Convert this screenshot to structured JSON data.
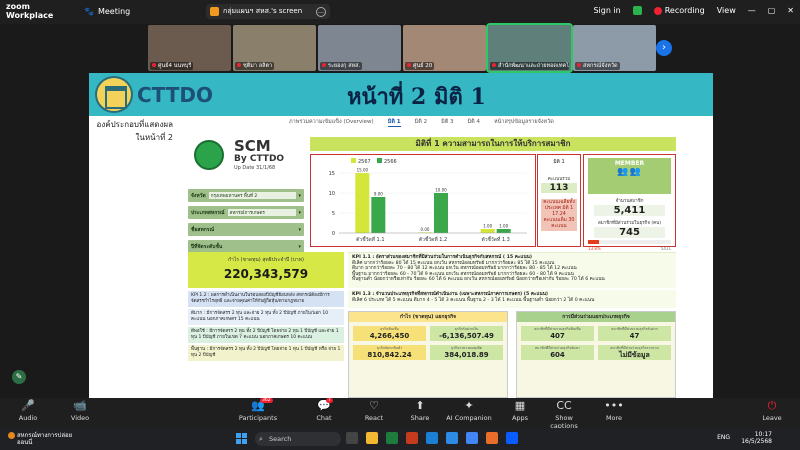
{
  "app": {
    "brand_line1": "zoom",
    "brand_line2": "Workplace",
    "meeting_label": "Meeting",
    "share_source": "กลุ่มแผนฯ สหส.'s screen",
    "sign_in": "Sign in",
    "recording": "Recording",
    "view": "View"
  },
  "participants_strip": [
    {
      "name": "ศูนย์4 นนทบุรี",
      "color": "#6b5b4e"
    },
    {
      "name": "ชุติมา ลลิตา",
      "color": "#8a7f6a"
    },
    {
      "name": "ระยองกุ สหส.",
      "color": "#7e8692"
    },
    {
      "name": "ศูนย์ 20",
      "color": "#a48876"
    },
    {
      "name": "สำนักพัฒนาและถ่ายทอดเทคโนฯ",
      "color": "#5e7f7a",
      "active": true
    },
    {
      "name": "สหกรณ์จังหวัด",
      "color": "#8d9aa7"
    }
  ],
  "slide": {
    "brand": "CTTDO",
    "title": "หน้าที่ 2 มิติ 1",
    "side_note_1": "องค์ประกอบที่แสดงผล",
    "side_note_2": "ในหน้าที่ 2",
    "tabs": [
      "ภาพรวมความเข้มแข็ง (Overview)",
      "มิติ 1",
      "มิติ 2",
      "มิติ 3",
      "มิติ 4",
      "หน้าสรุปข้อมูลรายจังหวัด"
    ],
    "scm": {
      "title": "SCM",
      "by": "By CTTDO",
      "update": "Up Date 31/1/68"
    },
    "filters": [
      {
        "label": "จังหวัด",
        "value": "กรุงเทพมหานคร พื้นที่ 2"
      },
      {
        "label": "ประเภทสหกรณ์",
        "value": "สหกรณ์การเกษตร"
      },
      {
        "label": "ชื่อสหกรณ์",
        "value": ""
      },
      {
        "label": "ปีที่จัดระดับชั้น",
        "value": ""
      }
    ],
    "dimension_title": "มิติที่ 1 ความสามารถในการให้บริการสมาชิก",
    "kpi1": {
      "label": "มิติ 1",
      "score_label": "คะแนนรวม",
      "score": "113",
      "avg_label": "คะแนนเฉลี่ยทั้งประเทศ มิติ 1",
      "avg": "17.24",
      "avg_suffix": "คะแนนเต็ม 30 คะแนน"
    },
    "member": {
      "header": "MEMBER",
      "total_label": "จำนวนสมาชิก",
      "total": "5,411",
      "active_label": "สมาชิกที่มีส่วนร่วมในธุรกิจ (คน)",
      "active": "745",
      "pct_text": "13.8%",
      "pct": 13.8,
      "bar_max_label": "5411"
    },
    "revenue": {
      "label": "กำไร (ขาดทุน) สุทธิประจำปี (บาท)",
      "value": "220,343,579"
    },
    "kpi12": {
      "head": "KPI 1.2 : ผลการดำเนินงานในรอบสองปีบัญชีย้อนหลัง สหกรณ์ต้องมีการจัดสรรกำไรสุทธิ และจ่ายคุณค่าให้กับผู้ถือหุ้น/ตามกฎหมาย",
      "items": [
        "ดีมาก : มีการจัดสรร 2 ทุน และจ่าย 2 ทุน ทั้ง 2 ปีบัญชี ภายใน/นอก 10 คะแนน นอกภาคเกษตร 15 คะแนน",
        "ดีพอใช้ : มีการจัดสรร 2 ทุน ทั้ง 2 ปีบัญชี โดยจ่าย 2 ทุน 1 ปีบัญชี และจ่าย 1 ทุน 1 ปีบัญชี ภายในเขต 7 คะแนน นอกภาคเกษตร 10 คะแนน",
        "พื้นฐาน : มีการจัดสรร 2 ทุน ทั้ง 2 ปีบัญชี โดยจ่าย 1 ทุน 1 ปีบัญชี หรือ จ่าย 1 ทุน 2 ปีบัญชี"
      ]
    },
    "kpi11": {
      "head": "KPI 1.1 : อัตราส่วนของสมาชิกที่มีส่วนร่วมในการดำเนินธุรกิจกับสหกรณ์ ( 15 คะแนน)",
      "lines": [
        "ดีเลิศ มากกว่าร้อยละ 80 ได้ 15 คะแนน ยกเว้น สหกรณ์ออมทรัพย์ มากกว่าร้อยละ 85 ได้ 15 คะแนน",
        "ดีมาก มากกว่าร้อยละ 70 - 80 ได้ 12 คะแนน ยกเว้น สหกรณ์ออมทรัพย์ มากกว่าร้อยละ 80 - 85 ได้ 12 คะแนน",
        "พื้นฐาน มากกว่าร้อยละ 60 - 70 ได้ 9 คะแนน ยกเว้น สหกรณ์ออมทรัพย์ มากกว่าร้อยละ 60 - 80 ได้ 9 คะแนน",
        "พื้นฐานต่ำ น้อยกว่าหรือเท่ากับ ร้อยละ 60 ได้ 6 คะแนน ยกเว้น สหกรณ์ออมทรัพย์ น้อยกว่าหรือเท่ากับ ร้อยละ 70 ได้ 6 คะแนน"
      ]
    },
    "kpi13": {
      "head": "KPI 1.3 : จำนวนประเภทธุรกิจที่สหกรณ์ดำเนินงาน (เฉพาะสหกรณ์ภาคการเกษตร) (5 คะแนน)",
      "line": "ดีเลิศ 6 ประเภท ได้ 5 คะแนน ดีมาก 4 - 5 ได้ 3 คะแนน พื้นฐาน 2 - 3 ได้ 1 คะแนน พื้นฐานต่ำ น้อยกว่า 2 ได้ 0 คะแนน"
    },
    "fin_panel": {
      "title": "กำไร (ขาดทุน) แยกธุรกิจ",
      "cells": [
        {
          "label": "ธุรกิจสินเชื่อ",
          "value": "4,266,450"
        },
        {
          "label": "ธุรกิจรับฝากเงิน",
          "value": "-6,136,507.49"
        },
        {
          "label": "ธุรกิจจัดหาสินค้า",
          "value": "810,842.24"
        },
        {
          "label": "ธุรกิจรวบรวมผลผลิต",
          "value": "384,018.89"
        }
      ]
    },
    "tax_panel": {
      "title": "การมีส่วนร่วมแยกประเภทธุรกิจ",
      "cells": [
        {
          "label": "สมาชิกที่มีส่วนร่วมธุรกิจสินเชื่อ",
          "value": "407"
        },
        {
          "label": "สมาชิกที่มีส่วนร่วมธุรกิจรับฝาก",
          "value": "47"
        },
        {
          "label": "สมาชิกที่มีส่วนร่วมธุรกิจจัดหา",
          "value": "604"
        },
        {
          "label": "สมาชิกที่มีส่วนร่วมธุรกิจรวบรวม",
          "value": "ไม่มีข้อมูล"
        }
      ]
    }
  },
  "chart_data": {
    "type": "bar",
    "categories": [
      "ตัวชี้วัดที่ 1.1",
      "ตัวชี้วัดที่ 1.2",
      "ตัวชี้วัดที่ 1.3"
    ],
    "series": [
      {
        "name": "2567",
        "color": "#d4e639",
        "values": [
          15.0,
          0.0,
          1.0
        ]
      },
      {
        "name": "2566",
        "color": "#3aa84a",
        "values": [
          9.0,
          10.0,
          1.0
        ]
      }
    ],
    "value_labels": [
      [
        "15.00",
        "0.00",
        "1.00"
      ],
      [
        "9.00",
        "10.00",
        "1.00"
      ]
    ],
    "yticks": [
      0,
      5,
      10,
      15
    ],
    "ylim": [
      0,
      16
    ]
  },
  "toolbar": [
    {
      "label": "Audio",
      "glyph": "🎤"
    },
    {
      "label": "Video",
      "glyph": "📹"
    },
    {
      "label": "Participants",
      "glyph": "👥",
      "badge": "362"
    },
    {
      "label": "Chat",
      "glyph": "💬",
      "badge": "7"
    },
    {
      "label": "React",
      "glyph": "♡"
    },
    {
      "label": "Share",
      "glyph": "⬆"
    },
    {
      "label": "AI Companion",
      "glyph": "✦"
    },
    {
      "label": "Apps",
      "glyph": "▦"
    },
    {
      "label": "Show captions",
      "glyph": "CC"
    },
    {
      "label": "More",
      "glyph": "•••"
    },
    {
      "label": "Leave",
      "glyph": "⏻"
    }
  ],
  "taskbar": {
    "weather_line1": "สหกรณ์ทางการปล่อย",
    "weather_line2": "ออนนี่",
    "search_placeholder": "Search",
    "lang": "ENG",
    "time": "10:17",
    "date": "16/5/2568"
  }
}
